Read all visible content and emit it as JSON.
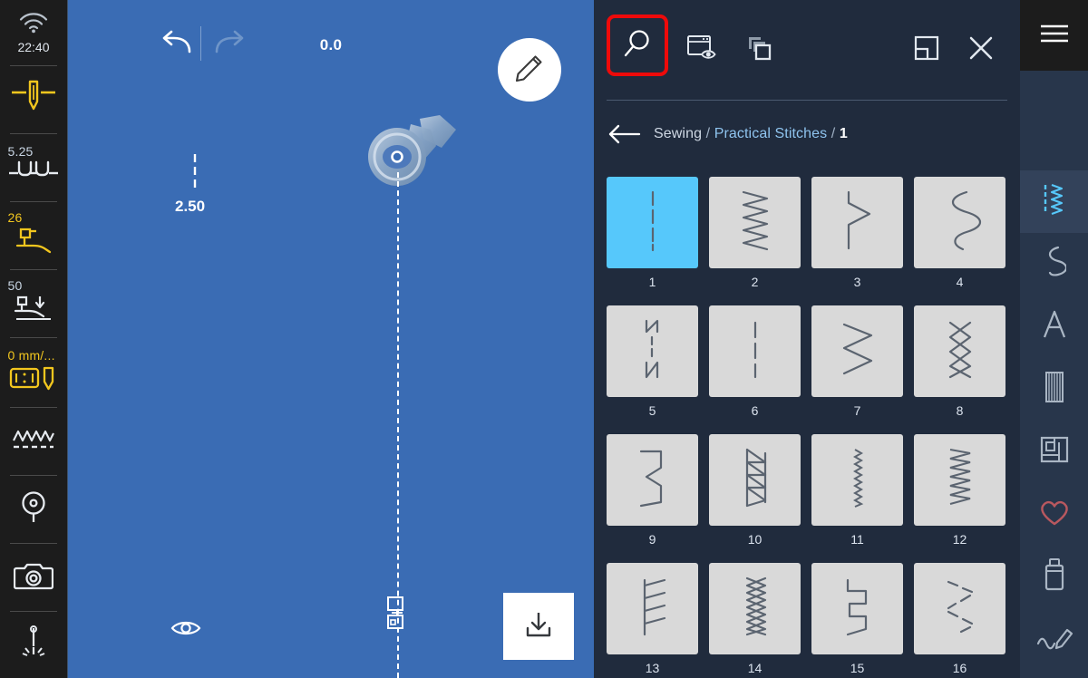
{
  "left_rail": {
    "wifi_icon": "wifi-icon",
    "time": "22:40",
    "items": [
      {
        "icon": "needle-position-icon",
        "value": "",
        "value_color": "none"
      },
      {
        "icon": "stitch-width-icon",
        "value": "5.25",
        "value_color": "blue"
      },
      {
        "icon": "presser-foot-icon",
        "value": "26",
        "value_color": "yellow"
      },
      {
        "icon": "presser-foot-pressure-icon",
        "value": "50",
        "value_color": "blue"
      },
      {
        "icon": "speed-icon",
        "value": "0 mm/...",
        "value_color": "yellow"
      },
      {
        "icon": "stitch-pattern-icon",
        "value": "",
        "value_color": "none"
      },
      {
        "icon": "bobbin-icon",
        "value": "",
        "value_color": "none"
      },
      {
        "icon": "camera-icon",
        "value": "",
        "value_color": "none"
      },
      {
        "icon": "needle-threader-icon",
        "value": "",
        "value_color": "none"
      }
    ]
  },
  "canvas": {
    "undo_label": "undo-icon",
    "redo_label": "redo-icon",
    "stitch_length_value": "0.0",
    "stitch_width_value": "2.50",
    "edit_icon": "pencil-icon",
    "eye_icon": "eye-icon",
    "save_icon": "save-download-icon",
    "background_color": "#3a6cb4"
  },
  "right_panel": {
    "toolbar": [
      {
        "name": "search-icon",
        "label": "Search",
        "highlighted": true
      },
      {
        "name": "preview-window-icon",
        "label": "Preview",
        "highlighted": false
      },
      {
        "name": "duplicate-icon",
        "label": "Duplicate",
        "highlighted": false
      },
      {
        "name": "resize-panel-icon",
        "label": "Resize",
        "highlighted": false
      },
      {
        "name": "close-icon",
        "label": "Close",
        "highlighted": false
      }
    ],
    "breadcrumb": {
      "back_icon": "back-arrow-icon",
      "root": "Sewing",
      "separator": "/",
      "category": "Practical Stitches",
      "current": "1"
    },
    "accent_selected": "#56c8fb",
    "panel_background": "#202b3d",
    "highlight_border": "#ee0a0a",
    "stitches": [
      {
        "number": "1",
        "icon": "straight-stitch",
        "selected": true
      },
      {
        "number": "2",
        "icon": "zigzag-stitch",
        "selected": false
      },
      {
        "number": "3",
        "icon": "wide-zigzag-stitch",
        "selected": false
      },
      {
        "number": "4",
        "icon": "wavy-stitch",
        "selected": false
      },
      {
        "number": "5",
        "icon": "reinforced-straight-stitch",
        "selected": false
      },
      {
        "number": "6",
        "icon": "basting-stitch",
        "selected": false
      },
      {
        "number": "7",
        "icon": "sharp-zigzag-stitch",
        "selected": false
      },
      {
        "number": "8",
        "icon": "cross-diamond-stitch",
        "selected": false
      },
      {
        "number": "9",
        "icon": "square-zigzag-stitch",
        "selected": false
      },
      {
        "number": "10",
        "icon": "triangle-ladder-stitch",
        "selected": false
      },
      {
        "number": "11",
        "icon": "fine-zigzag-stitch",
        "selected": false
      },
      {
        "number": "12",
        "icon": "stretch-zigzag-stitch",
        "selected": false
      },
      {
        "number": "13",
        "icon": "overlock-stitch",
        "selected": false
      },
      {
        "number": "14",
        "icon": "braided-stitch",
        "selected": false
      },
      {
        "number": "15",
        "icon": "square-wave-stitch",
        "selected": false
      },
      {
        "number": "16",
        "icon": "dashed-zigzag-stitch",
        "selected": false
      }
    ]
  },
  "far_rail": {
    "menu_icon": "hamburger-menu-icon",
    "items": [
      {
        "name": "practical-stitches-icon",
        "active": true
      },
      {
        "name": "decorative-stitch-icon",
        "active": false
      },
      {
        "name": "alphabet-icon",
        "active": false
      },
      {
        "name": "buttonhole-icon",
        "active": false
      },
      {
        "name": "quilting-icon",
        "active": false
      },
      {
        "name": "favorites-heart-icon",
        "active": false
      },
      {
        "name": "usb-stick-icon",
        "active": false
      },
      {
        "name": "stitch-designer-icon",
        "active": false
      }
    ]
  }
}
